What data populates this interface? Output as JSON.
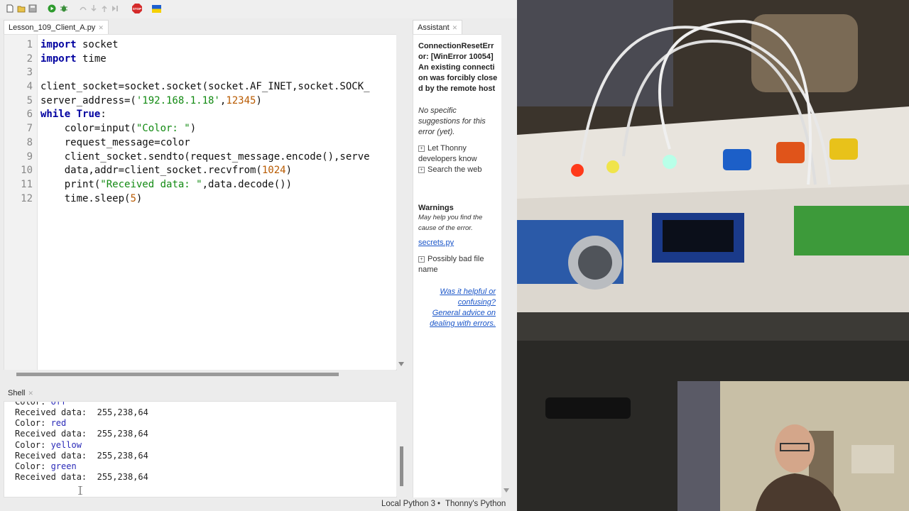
{
  "toolbar": {
    "icons": [
      "new-file-icon",
      "open-file-icon",
      "save-icon",
      "run-icon",
      "debug-icon",
      "step-over-icon",
      "step-into-icon",
      "step-out-icon",
      "resume-icon",
      "stop-icon",
      "ukraine-flag-icon"
    ],
    "stop_label": "STOP"
  },
  "editor": {
    "tab_label": "Lesson_109_Client_A.py",
    "line_numbers": [
      "1",
      "2",
      "3",
      "4",
      "5",
      "6",
      "7",
      "8",
      "9",
      "10",
      "11",
      "12"
    ]
  },
  "code": {
    "l1": {
      "kw": "import",
      "rest": " socket"
    },
    "l2": {
      "kw": "import",
      "rest": " time"
    },
    "l4": {
      "text": "client_socket=socket.socket(socket.AF_INET,socket.SOCK_"
    },
    "l5": {
      "a": "server_address=(",
      "s": "'192.168.1.18'",
      "b": ",",
      "n": "12345",
      "c": ")"
    },
    "l6": {
      "kw": "while",
      "sp": " ",
      "kw2": "True",
      "c": ":"
    },
    "l7": {
      "a": "    color=input(",
      "s": "\"Color: \"",
      "c": ")"
    },
    "l8": {
      "text": "    request_message=color"
    },
    "l9": {
      "text": "    client_socket.sendto(request_message.encode(),serve"
    },
    "l10": {
      "a": "    data,addr=client_socket.recvfrom(",
      "n": "1024",
      "c": ")"
    },
    "l11": {
      "a": "    print(",
      "s": "\"Received data: \"",
      "c": ",data.decode())"
    },
    "l12": {
      "a": "    time.sleep(",
      "n": "5",
      "c": ")"
    }
  },
  "shell": {
    "tab_label": "Shell",
    "lines": [
      {
        "prompt": "Color: ",
        "input": "off"
      },
      {
        "text": "Received data:  255,238,64"
      },
      {
        "prompt": "Color: ",
        "input": "red"
      },
      {
        "text": "Received data:  255,238,64"
      },
      {
        "prompt": "Color: ",
        "input": "yellow"
      },
      {
        "text": "Received data:  255,238,64"
      },
      {
        "prompt": "Color: ",
        "input": "green"
      },
      {
        "text": "Received data:  255,238,64"
      }
    ]
  },
  "assistant": {
    "tab_label": "Assistant",
    "error_title": "ConnectionResetError: [WinError 10054] An existing connection was forcibly closed by the remote host",
    "no_suggestions": "No specific suggestions for this error (yet).",
    "let_thonny": "Let Thonny developers know",
    "search_web": "Search the web",
    "warnings_title": "Warnings",
    "warnings_sub": "May help you find the cause of the error.",
    "file_link": "secrets.py",
    "bad_file": "Possibly bad file name",
    "helpful": "Was it helpful or confusing?",
    "advice": "General advice on dealing with errors."
  },
  "status": {
    "interpreter": "Local Python 3",
    "separator": "•",
    "python": "Thonny's Python"
  },
  "colors": {
    "keyword": "#0000a0",
    "string": "#128a12",
    "number": "#b85a00",
    "link": "#1a55c8",
    "stop": "#d42a2a"
  }
}
